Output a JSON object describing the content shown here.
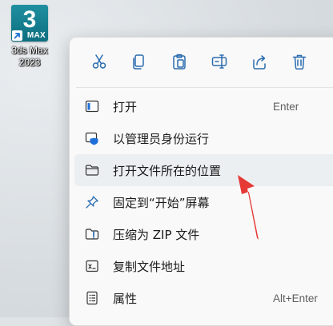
{
  "desktop": {
    "app_icon": {
      "number": "3",
      "brand": "MAX",
      "label_line1": "3ds Max",
      "label_line2": "2023",
      "icon": "3ds-max-app-icon",
      "overlay_icon": "shortcut-arrow-icon"
    }
  },
  "context_menu": {
    "toolbar": [
      {
        "name": "cut",
        "icon": "scissors-icon"
      },
      {
        "name": "copy",
        "icon": "copy-icon"
      },
      {
        "name": "paste",
        "icon": "paste-icon"
      },
      {
        "name": "rename",
        "icon": "rename-icon"
      },
      {
        "name": "share",
        "icon": "share-icon"
      },
      {
        "name": "delete",
        "icon": "trash-icon"
      }
    ],
    "items": [
      {
        "label": "打开",
        "shortcut": "Enter",
        "icon": "open-window-icon"
      },
      {
        "label": "以管理员身份运行",
        "shortcut": "",
        "icon": "admin-shield-icon"
      },
      {
        "label": "打开文件所在的位置",
        "shortcut": "",
        "icon": "folder-icon",
        "highlighted": true
      },
      {
        "label": "固定到“开始”屏幕",
        "shortcut": "",
        "icon": "pin-icon"
      },
      {
        "label": "压缩为 ZIP 文件",
        "shortcut": "",
        "icon": "zip-folder-icon"
      },
      {
        "label": "复制文件地址",
        "shortcut": "",
        "icon": "copy-path-icon"
      },
      {
        "label": "属性",
        "shortcut": "Alt+Enter",
        "icon": "properties-icon"
      }
    ]
  },
  "annotation": {
    "icon": "red-arrow-icon",
    "color": "#e53935"
  }
}
